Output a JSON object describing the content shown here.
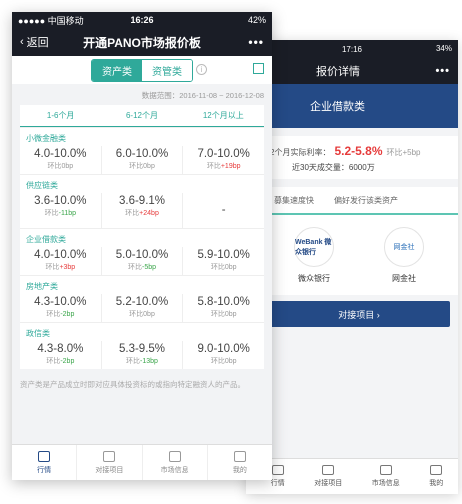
{
  "back_screen": {
    "status": {
      "time": "17:16",
      "battery": "34%"
    },
    "nav": {
      "title": "报价详情",
      "more": "•••"
    },
    "hero_title": "企业借款类",
    "rate_label": "2个月实际利率：",
    "rate_value": "5.2-5.8%",
    "rate_change": "环比+5bp",
    "volume": "近30天成交量：6000万",
    "tabs": [
      "募集速度快",
      "偏好发行该类资产"
    ],
    "institutions": [
      {
        "name": "微众银行",
        "logo_text": "WeBank 微众银行"
      },
      {
        "name": "网金社",
        "logo_text": "网金社"
      }
    ],
    "cta": "对接项目 ›",
    "tabbar": [
      "行情",
      "对接项目",
      "市场信息",
      "我的"
    ]
  },
  "front_screen": {
    "status": {
      "carrier": "●●●●● 中国移动",
      "time": "16:26",
      "battery": "42%"
    },
    "nav": {
      "back": "返回",
      "title": "开通PANO市场报价板",
      "more": "•••"
    },
    "toggle": {
      "asset": "资产类",
      "fund": "资管类"
    },
    "range": "数据范围：2016-11-08 ~ 2016-12-08",
    "columns": [
      "1-6个月",
      "6-12个月",
      "12个月以上"
    ],
    "categories": [
      {
        "name": "小微金融类",
        "cells": [
          {
            "value": "4.0-10.0%",
            "change": "环比0bp",
            "dir": "flat"
          },
          {
            "value": "6.0-10.0%",
            "change": "环比0bp",
            "dir": "flat"
          },
          {
            "value": "7.0-10.0%",
            "change": "环比+19bp",
            "dir": "up"
          }
        ]
      },
      {
        "name": "供应链类",
        "cells": [
          {
            "value": "3.6-10.0%",
            "change": "环比-11bp",
            "dir": "dn"
          },
          {
            "value": "3.6-9.1%",
            "change": "环比+24bp",
            "dir": "up"
          },
          {
            "value": "-",
            "change": "",
            "dir": "none"
          }
        ]
      },
      {
        "name": "企业借款类",
        "cells": [
          {
            "value": "4.0-10.0%",
            "change": "环比+3bp",
            "dir": "up"
          },
          {
            "value": "5.0-10.0%",
            "change": "环比-5bp",
            "dir": "dn"
          },
          {
            "value": "5.9-10.0%",
            "change": "环比0bp",
            "dir": "flat"
          }
        ]
      },
      {
        "name": "房地产类",
        "cells": [
          {
            "value": "4.3-10.0%",
            "change": "环比-2bp",
            "dir": "dn"
          },
          {
            "value": "5.2-10.0%",
            "change": "环比0bp",
            "dir": "flat"
          },
          {
            "value": "5.8-10.0%",
            "change": "环比0bp",
            "dir": "flat"
          }
        ]
      },
      {
        "name": "政信类",
        "cells": [
          {
            "value": "4.3-8.0%",
            "change": "环比-2bp",
            "dir": "dn"
          },
          {
            "value": "5.3-9.5%",
            "change": "环比-13bp",
            "dir": "dn"
          },
          {
            "value": "9.0-10.0%",
            "change": "环比0bp",
            "dir": "flat"
          }
        ]
      }
    ],
    "note": "资产类是产品成立时即对应具体投资标的或指向特定融资人的产品。",
    "tabbar": [
      "行情",
      "对接项目",
      "市场信息",
      "我的"
    ]
  },
  "colors": {
    "accent": "#2fa99a",
    "navy": "#244a86",
    "up": "#e63b3b",
    "down": "#3aa54a"
  }
}
